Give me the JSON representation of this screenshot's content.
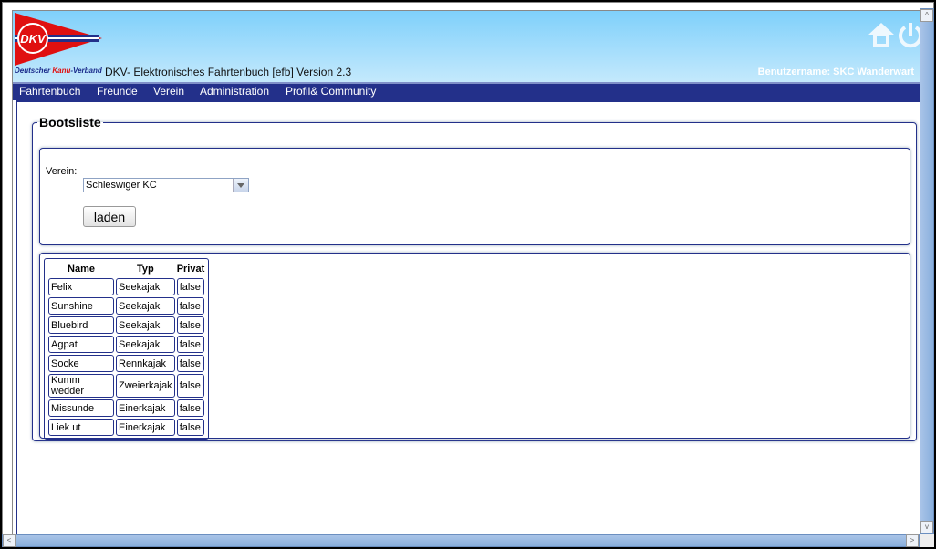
{
  "header": {
    "logo_text_1": "Deutscher ",
    "logo_text_2": "Kanu",
    "logo_text_3": "-Verband",
    "logo_letters": "DKV",
    "title": "DKV- Elektronisches Fahrtenbuch [efb] Version 2.3",
    "user": "Benutzername: SKC Wanderwart"
  },
  "nav": [
    "Fahrtenbuch",
    "Freunde",
    "Verein",
    "Administration",
    "Profil& Community"
  ],
  "bootsliste": {
    "legend": "Bootsliste",
    "verein_label": "Verein:",
    "verein_value": "Schleswiger KC",
    "load_button": "laden",
    "columns": [
      "Name",
      "Typ",
      "Privat"
    ],
    "rows": [
      [
        "Felix",
        "Seekajak",
        "false"
      ],
      [
        "Sunshine",
        "Seekajak",
        "false"
      ],
      [
        "Bluebird",
        "Seekajak",
        "false"
      ],
      [
        "Agpat",
        "Seekajak",
        "false"
      ],
      [
        "Socke",
        "Rennkajak",
        "false"
      ],
      [
        "Kumm wedder",
        "Zweierkajak",
        "false"
      ],
      [
        "Missunde",
        "Einerkajak",
        "false"
      ],
      [
        "Liek ut",
        "Einerkajak",
        "false"
      ]
    ]
  },
  "colors": {
    "nav": "#23308a",
    "header_top": "#7fd0fb",
    "header_bottom": "#c4e9fc",
    "flag_red": "#e01010"
  }
}
